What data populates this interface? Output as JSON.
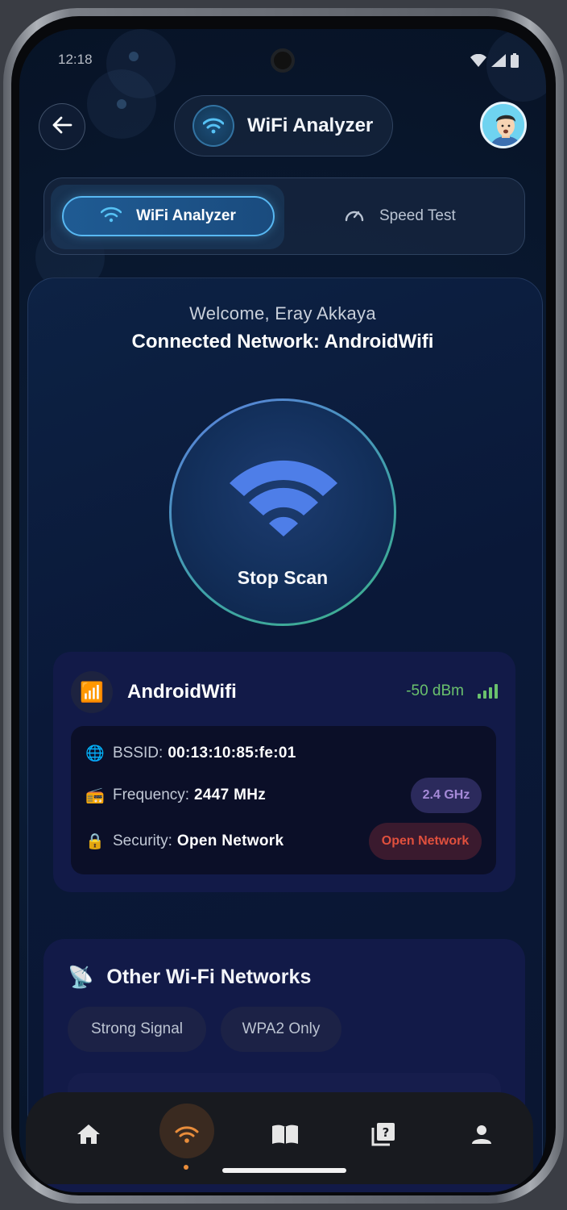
{
  "status_bar": {
    "time": "12:18"
  },
  "header": {
    "back_label": "back",
    "title": "WiFi Analyzer"
  },
  "tabs": [
    {
      "label": "WiFi Analyzer",
      "icon": "wifi-icon",
      "active": true
    },
    {
      "label": "Speed Test",
      "icon": "speedometer-icon",
      "active": false
    }
  ],
  "main": {
    "welcome": "Welcome, Eray Akkaya",
    "connected": "Connected Network: AndroidWifi",
    "scan_button": "Stop Scan"
  },
  "network": {
    "icon": "📶",
    "name": "AndroidWifi",
    "signal": "-50 dBm",
    "bssid_label": "BSSID:",
    "bssid": "00:13:10:85:fe:01",
    "frequency_label": "Frequency:",
    "frequency": "2447 MHz",
    "band_badge": "2.4 GHz",
    "security_label": "Security:",
    "security": "Open Network",
    "security_badge": "Open Network",
    "icons": {
      "bssid": "🌐",
      "frequency": "📻",
      "security": "🔒"
    }
  },
  "other_networks": {
    "icon": "📡",
    "title": "Other Wi-Fi Networks",
    "filters": [
      "Strong Signal",
      "WPA2 Only"
    ]
  },
  "bottom_nav": [
    {
      "icon": "home-icon",
      "active": false
    },
    {
      "icon": "wifi-icon",
      "active": true
    },
    {
      "icon": "book-icon",
      "active": false
    },
    {
      "icon": "quiz-icon",
      "active": false
    },
    {
      "icon": "person-icon",
      "active": false
    }
  ],
  "colors": {
    "accent_blue": "#58b8f2",
    "signal_green": "#6ac16d",
    "open_red": "#e0503d",
    "ghz_purple": "#a58ad8",
    "nav_orange": "#e98d3b"
  }
}
